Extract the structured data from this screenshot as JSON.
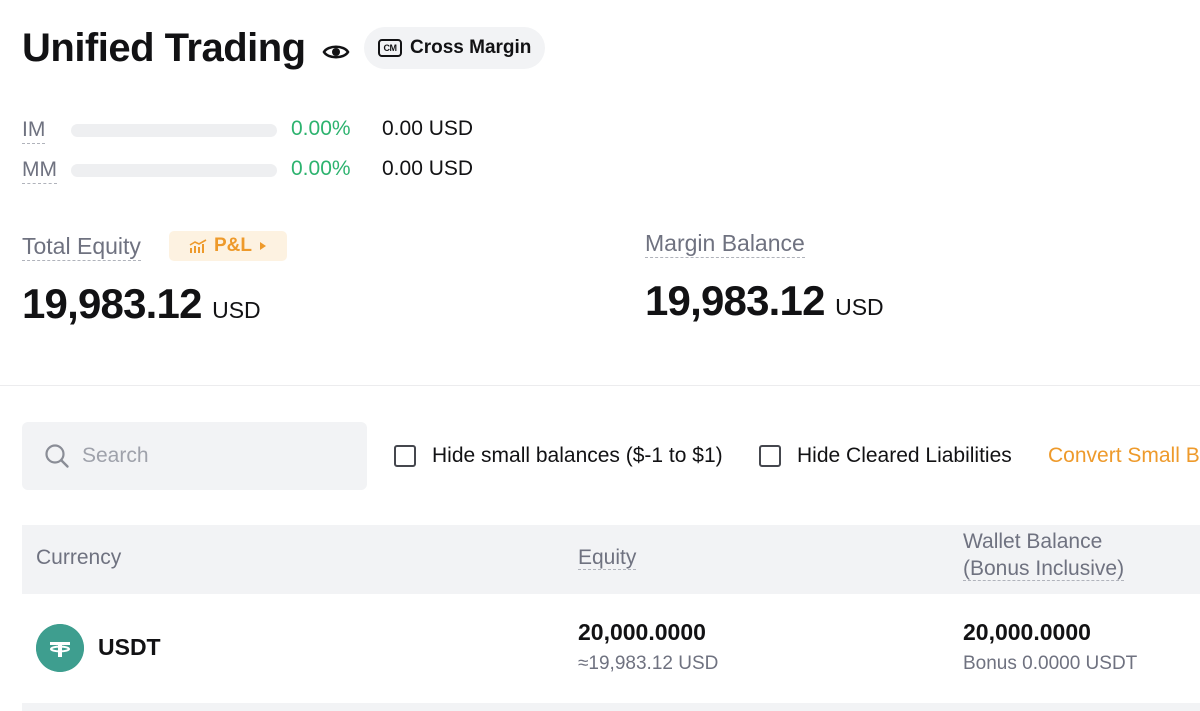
{
  "header": {
    "title": "Unified Trading",
    "mode_badge": {
      "icon_text": "CM",
      "label": "Cross Margin"
    }
  },
  "margin_ratios": [
    {
      "label": "IM",
      "percent": "0.00%",
      "fill_fraction": 0,
      "amount": "0.00 USD"
    },
    {
      "label": "MM",
      "percent": "0.00%",
      "fill_fraction": 0,
      "amount": "0.00 USD"
    }
  ],
  "total_equity": {
    "label": "Total Equity",
    "pnl_button": "P&L",
    "value": "19,983.12",
    "unit": "USD"
  },
  "margin_balance": {
    "label": "Margin Balance",
    "value": "19,983.12",
    "unit": "USD"
  },
  "filters": {
    "search_placeholder": "Search",
    "search_value": "",
    "hide_small_balances": {
      "label": "Hide small balances ($-1 to $1)",
      "checked": false
    },
    "hide_cleared_liabilities": {
      "label": "Hide Cleared Liabilities",
      "checked": false
    },
    "convert_link": "Convert Small B"
  },
  "table": {
    "columns": {
      "currency": "Currency",
      "equity": "Equity",
      "wallet_balance_line1": "Wallet Balance",
      "wallet_balance_line2": "(Bonus Inclusive)"
    },
    "rows": [
      {
        "currency": "USDT",
        "icon": "tether-icon",
        "equity": "20,000.0000",
        "equity_usd": "≈19,983.12 USD",
        "wallet_balance": "20,000.0000",
        "bonus": "Bonus 0.0000 USDT"
      }
    ]
  },
  "colors": {
    "positive": "#2db36f",
    "accent": "#ee9a2b",
    "muted_text": "#6f7280",
    "tether": "#3e9e8f"
  }
}
